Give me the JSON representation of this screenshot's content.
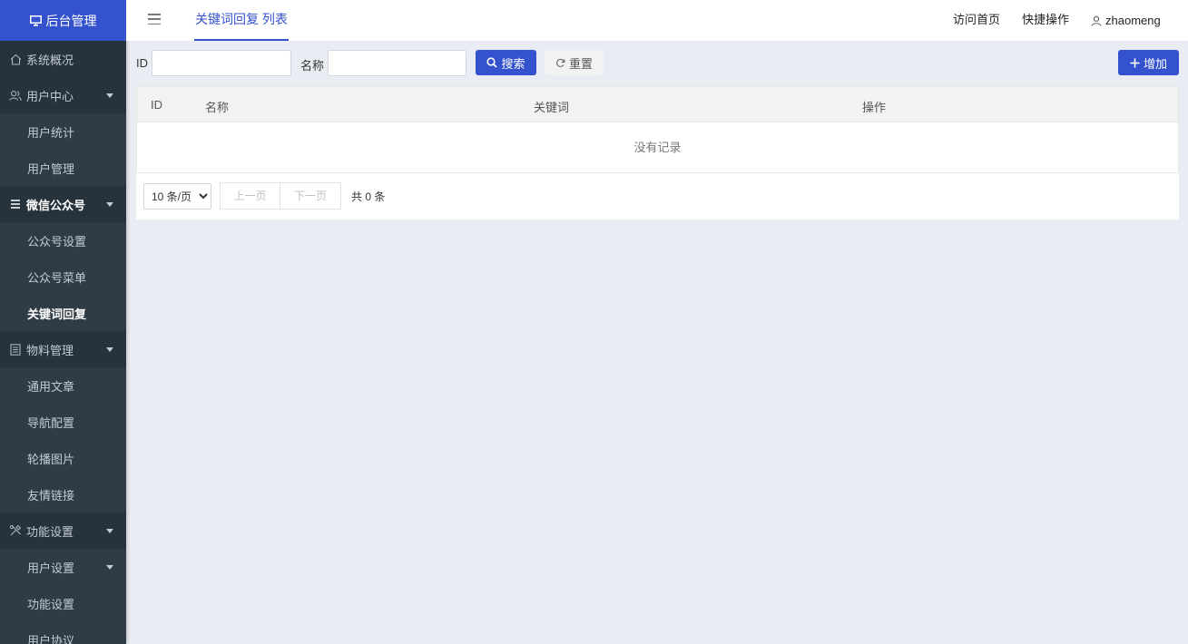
{
  "brand": {
    "title": "后台管理",
    "icon": "monitor-icon"
  },
  "sidebar": {
    "groups": [
      {
        "label": "系统概况",
        "icon": "home-icon",
        "has_caret": false
      },
      {
        "label": "用户中心",
        "icon": "users-icon",
        "has_caret": true,
        "items": [
          {
            "label": "用户统计"
          },
          {
            "label": "用户管理"
          }
        ]
      },
      {
        "label": "微信公众号",
        "icon": "menu-lines-icon",
        "has_caret": true,
        "active": true,
        "items": [
          {
            "label": "公众号设置"
          },
          {
            "label": "公众号菜单"
          },
          {
            "label": "关键词回复",
            "current": true
          }
        ]
      },
      {
        "label": "物料管理",
        "icon": "document-icon",
        "has_caret": true,
        "items": [
          {
            "label": "通用文章"
          },
          {
            "label": "导航配置"
          },
          {
            "label": "轮播图片"
          },
          {
            "label": "友情链接"
          }
        ]
      },
      {
        "label": "功能设置",
        "icon": "tools-icon",
        "has_caret": true,
        "items": [
          {
            "label": "用户设置",
            "has_caret": true
          },
          {
            "label": "功能设置"
          },
          {
            "label": "用户协议"
          }
        ]
      }
    ]
  },
  "header": {
    "menu_icon": "hamburger-icon",
    "tab_label": "关键词回复 列表",
    "links": {
      "visit_home": "访问首页",
      "quick_ops": "快捷操作"
    },
    "username": "zhaomeng",
    "user_icon": "user-icon"
  },
  "search": {
    "id_label": "ID",
    "id_value": "",
    "name_label": "名称",
    "name_value": "",
    "search_button": "搜索",
    "reset_button": "重置",
    "add_button": "增加"
  },
  "table": {
    "columns": [
      "ID",
      "名称",
      "关键词",
      "操作"
    ],
    "rows": [],
    "empty_text": "没有记录"
  },
  "pagination": {
    "page_size_options": [
      "10 条/页"
    ],
    "page_size_selected": "10 条/页",
    "prev_label": "上一页",
    "next_label": "下一页",
    "total_text": "共 0 条"
  },
  "colors": {
    "accent": "#3452ce",
    "sidebar_bg": "#2f3c46",
    "sidebar_group_bg": "#27333c",
    "content_bg": "#e9ecf2"
  }
}
